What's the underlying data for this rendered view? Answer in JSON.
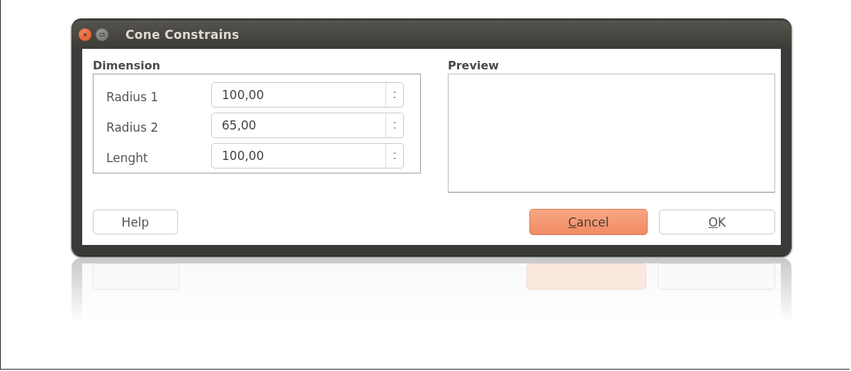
{
  "window": {
    "title": "Cone Constrains"
  },
  "dimension": {
    "title": "Dimension",
    "fields": [
      {
        "label": "Radius 1",
        "value": "100,00"
      },
      {
        "label": "Radius 2",
        "value": "65,00"
      },
      {
        "label": "Lenght",
        "value": "100,00"
      }
    ]
  },
  "preview": {
    "title": "Preview"
  },
  "buttons": [
    {
      "kind": "plain",
      "text": "Help"
    },
    {
      "kind": "default",
      "underlined": "C",
      "text": "ancel"
    },
    {
      "kind": "plain",
      "underlined": "O",
      "text": "K"
    }
  ]
}
